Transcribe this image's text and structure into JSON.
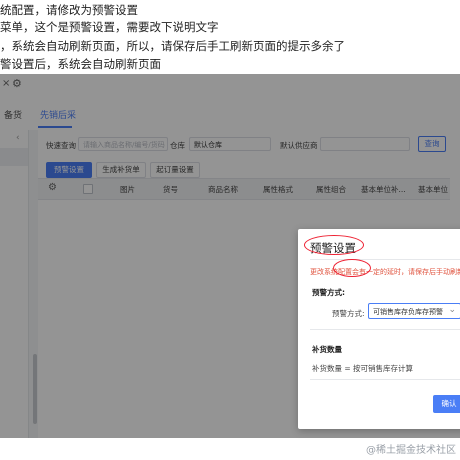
{
  "notes": [
    "统配置，请修改为预警设置",
    "菜单，这个是预警设置，需要改下说明文字",
    "，系统会自动刷新页面，所以，请保存后手工刷新页面的提示多余了",
    "警设置后，系统会自动刷新页面"
  ],
  "topbar": {
    "close_glyph": "×",
    "gear_icon": "gear-icon"
  },
  "tabs": [
    {
      "label": "备货"
    },
    {
      "label": "先销后采"
    }
  ],
  "filters": {
    "quick_query_label": "快速查询",
    "quick_query_placeholder": "请输入商品名称/编号/货码",
    "warehouse_label": "仓库",
    "warehouse_value": "默认仓库",
    "supplier_label": "默认供应商",
    "query_button": "查询"
  },
  "toolbar": {
    "warning_settings": "预警设置",
    "generate_order": "生成补货单",
    "min_order_settings": "起订量设置"
  },
  "table": {
    "columns": [
      "图片",
      "货号",
      "商品名称",
      "属性格式",
      "属性组合",
      "基本单位补...",
      "基本单位"
    ]
  },
  "modal": {
    "title": "预警设置",
    "warning": "更改系统配置会有一定的延时，请保存后手动刷新",
    "warning_mode_title": "预警方式:",
    "warning_mode_label": "预警方式:",
    "warning_mode_value": "可销售库存负库存预警",
    "replenish_title": "补货数量",
    "replenish_text": "补货数量 = 按可销售库存计算",
    "confirm_button": "确认"
  },
  "watermark": "@稀土掘金技术社区",
  "colors": {
    "accent": "#4a7ef6",
    "warning": "#e0533e",
    "annotation": "#e22233"
  }
}
